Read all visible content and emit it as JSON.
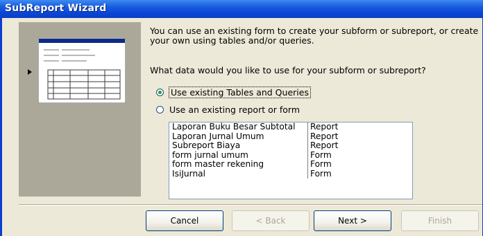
{
  "window": {
    "title": "SubReport Wizard"
  },
  "intro_text": "You can use an existing form to create your subform or subreport, or create your own using tables and/or queries.",
  "question": "What data would you like to use for your subform or subreport?",
  "options": [
    {
      "label": "Use existing Tables and Queries",
      "selected": true
    },
    {
      "label": "Use an existing report or form",
      "selected": false
    }
  ],
  "list": [
    {
      "name": "Laporan Buku Besar Subtotal",
      "type": "Report"
    },
    {
      "name": "Laporan Jurnal Umum",
      "type": "Report"
    },
    {
      "name": "Subreport Biaya",
      "type": "Report"
    },
    {
      "name": "form jurnal umum",
      "type": "Form"
    },
    {
      "name": "form master rekening",
      "type": "Form"
    },
    {
      "name": "IsiJurnal",
      "type": "Form"
    }
  ],
  "buttons": {
    "cancel": "Cancel",
    "back": "< Back",
    "next": "Next >",
    "finish": "Finish"
  },
  "colors": {
    "titlebar": "#0a46d6",
    "dialog_bg": "#ece9d8",
    "panel_bg": "#aca899",
    "radio_dot": "#21a121"
  }
}
